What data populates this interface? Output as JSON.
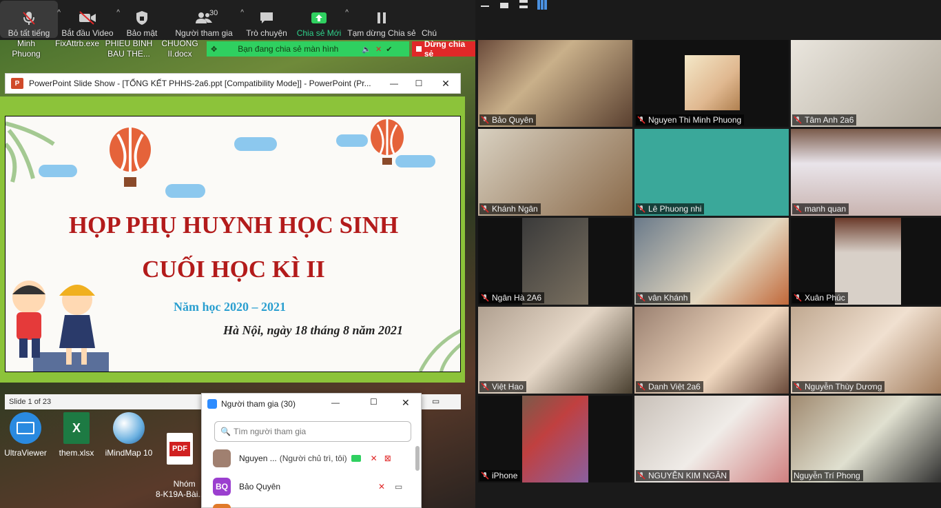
{
  "toolbar": {
    "mute_all": "Bỏ tất tiếng",
    "start_video": "Bắt đầu Video",
    "security": "Bảo mật",
    "participants": "Người tham gia",
    "participants_count": "30",
    "chat": "Trò chuyện",
    "share_new": "Chia sẻ Mới",
    "pause_share": "Tạm dừng Chia sẻ",
    "more": "Chú"
  },
  "desktop_top": {
    "item1": "Minh\nPhuong",
    "item2": "FixAttrb.exe",
    "item3": "PHIEU BINH\nBAU THE...",
    "item4": "CHUONG\nII.docx"
  },
  "share_banner": {
    "text": "Bạn đang chia sẻ màn hình",
    "stop": "Dừng chia sẻ"
  },
  "ppt": {
    "window_title": "PowerPoint Slide Show - [TỔNG KẾT PHHS-2a6.ppt [Compatibility Mode]] - PowerPoint (Pr...",
    "slide_title1": "HỌP PHỤ HUYNH HỌC SINH",
    "slide_title2": "CUỐI HỌC KÌ II",
    "slide_year": "Năm học 2020 – 2021",
    "slide_date": "Hà Nội, ngày 18 tháng 8 năm 2021",
    "status": "Slide 1 of 23"
  },
  "desktop_icons": [
    {
      "label": "UltraViewer"
    },
    {
      "label": "them.xlsx"
    },
    {
      "label": "iMindMap 10"
    },
    {
      "label": "Nhóm\n8-K19A-Bài..."
    }
  ],
  "participants_panel": {
    "title": "Người tham gia (30)",
    "search_placeholder": "Tìm người tham gia",
    "rows": [
      {
        "name": "Nguyen ...",
        "role": "(Người chủ trì, tôi)",
        "initials": ""
      },
      {
        "name": "Bảo Quyên",
        "role": "",
        "initials": "BQ"
      }
    ]
  },
  "gallery": [
    {
      "name": "Bảo Quyên"
    },
    {
      "name": "Nguyen Thi Minh Phuong"
    },
    {
      "name": "Tâm Anh 2a6"
    },
    {
      "name": "Khánh Ngân"
    },
    {
      "name": "Lê Phuong nhi"
    },
    {
      "name": "manh quan"
    },
    {
      "name": "Ngân Hà 2A6"
    },
    {
      "name": "vân Khánh"
    },
    {
      "name": "Xuân Phúc"
    },
    {
      "name": "Việt Hao"
    },
    {
      "name": "Danh Việt 2a6"
    },
    {
      "name": "Nguyễn Thùy Dương"
    },
    {
      "name": "iPhone"
    },
    {
      "name": "NGUYỄN KIM NGÂN"
    },
    {
      "name": "Nguyễn Trí Phong"
    }
  ],
  "colors": {
    "zoom_green": "#2fd060",
    "stop_red": "#e02828",
    "title_red": "#b31b1b",
    "slide_frame": "#8cc33a",
    "year_blue": "#2a9fd0"
  }
}
